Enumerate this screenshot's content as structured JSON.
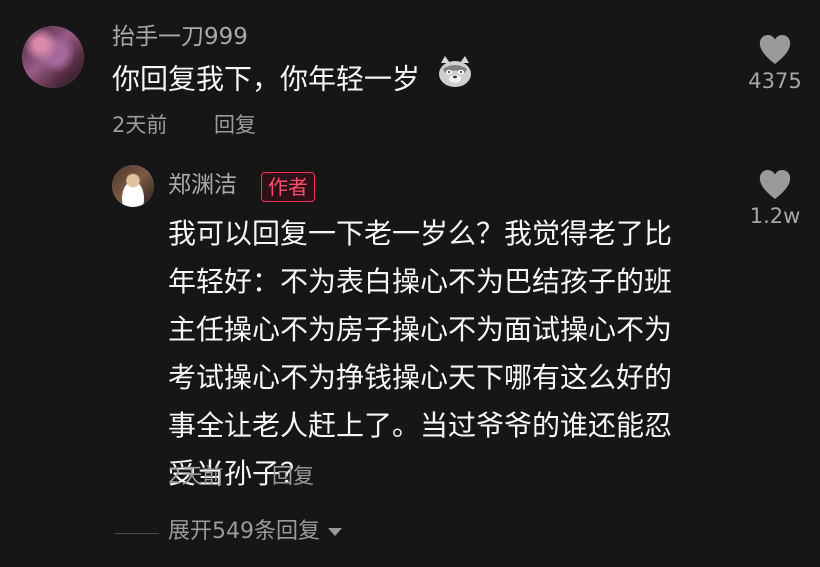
{
  "comments": {
    "top": {
      "username": "抬手一刀999",
      "text": "你回复我下，你年轻一岁",
      "emoji_icon": "wolf-face-icon",
      "time": "2天前",
      "reply_label": "回复",
      "likes": "4375"
    },
    "reply": {
      "username": "郑渊洁",
      "author_badge": "作者",
      "lines": [
        "我可以回复一下老一岁么？我觉得老了比",
        "年轻好：不为表白操心不为巴结孩子的班",
        "主任操心不为房子操心不为面试操心不为",
        "考试操心不为挣钱操心天下哪有这么好的",
        "事全让老人赶上了。当过爷爷的谁还能忍",
        "受当孙子？"
      ],
      "time": "2天前",
      "reply_label": "回复",
      "likes": "1.2w"
    }
  },
  "expand_replies": "展开549条回复",
  "colors": {
    "background": "#161616",
    "accent_badge": "#ff2c55",
    "muted_text": "#9b9b9b"
  }
}
